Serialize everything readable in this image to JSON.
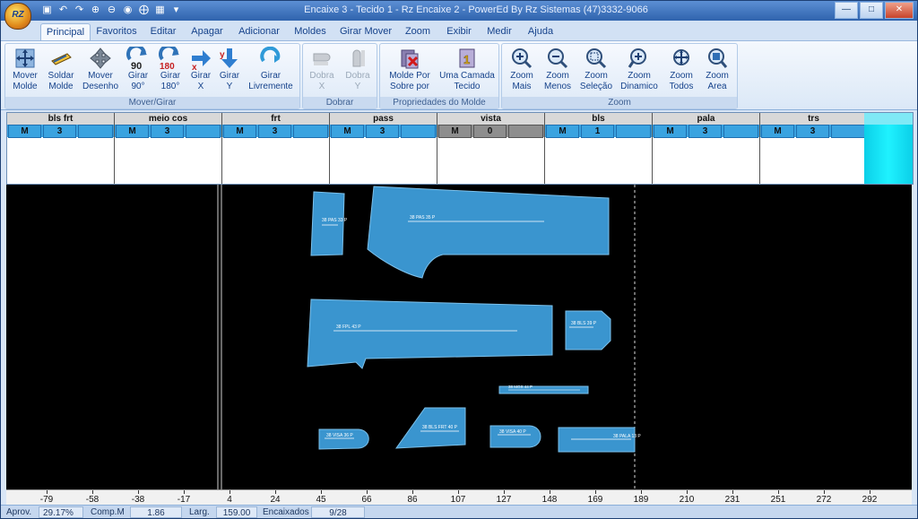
{
  "window": {
    "title": "Encaixe 3 - Tecido 1 - Rz Encaixe 2 - PowerEd By Rz Sistemas (47)3332-9066",
    "logo_text": "RZ"
  },
  "quick_access": [
    "save-icon",
    "undo-icon",
    "redo-icon",
    "zoom-in-icon",
    "zoom-out-icon",
    "zoom-fit-icon",
    "zoom-all-icon",
    "zoom-area-icon",
    "dropdown-icon"
  ],
  "tabs": [
    {
      "label": "Principal",
      "active": true
    },
    {
      "label": "Favoritos"
    },
    {
      "label": "Editar"
    },
    {
      "label": "Apagar"
    },
    {
      "label": "Adicionar"
    },
    {
      "label": "Moldes"
    },
    {
      "label": "Girar Mover"
    },
    {
      "label": "Zoom"
    },
    {
      "label": "Exibir"
    },
    {
      "label": "Medir"
    },
    {
      "label": "Ajuda"
    }
  ],
  "ribbon": {
    "mover_girar": {
      "label": "Mover/Girar",
      "buttons": [
        {
          "label": "Mover\nMolde",
          "icon": "move-piece-icon"
        },
        {
          "label": "Soldar\nMolde",
          "icon": "weld-piece-icon"
        },
        {
          "label": "Mover\nDesenho",
          "icon": "move-drawing-icon"
        },
        {
          "label": "Girar\n90°",
          "icon": "rotate-90-icon",
          "badge": "90"
        },
        {
          "label": "Girar\n180°",
          "icon": "rotate-180-icon",
          "badge": "180"
        },
        {
          "label": "Girar\nX",
          "icon": "flip-x-icon"
        },
        {
          "label": "Girar\nY",
          "icon": "flip-y-icon"
        },
        {
          "label": "Girar\nLivremente",
          "icon": "rotate-free-icon"
        }
      ]
    },
    "dobrar": {
      "label": "Dobrar",
      "buttons": [
        {
          "label": "Dobra\nX",
          "icon": "fold-x-icon"
        },
        {
          "label": "Dobra\nY",
          "icon": "fold-y-icon"
        }
      ]
    },
    "propriedades": {
      "label": "Propriedades do Molde",
      "buttons": [
        {
          "label": "Molde Por\nSobre por",
          "icon": "piece-overlap-icon"
        },
        {
          "label": "Uma Camada\nTecido",
          "icon": "single-layer-icon",
          "badge": "1"
        }
      ]
    },
    "zoom": {
      "label": "Zoom",
      "buttons": [
        {
          "label": "Zoom\nMais",
          "icon": "zoom-in-icon"
        },
        {
          "label": "Zoom\nMenos",
          "icon": "zoom-out-icon"
        },
        {
          "label": "Zoom\nSeleção",
          "icon": "zoom-selection-icon"
        },
        {
          "label": "Zoom\nDinamico",
          "icon": "zoom-dynamic-icon"
        },
        {
          "label": "Zoom\nTodos",
          "icon": "zoom-all-icon"
        },
        {
          "label": "Zoom\nArea",
          "icon": "zoom-area-icon"
        }
      ]
    }
  },
  "pieces_table": [
    {
      "name": "bls frt",
      "size": "M",
      "qty": "3"
    },
    {
      "name": "meio cos",
      "size": "M",
      "qty": "3"
    },
    {
      "name": "frt",
      "size": "M",
      "qty": "3"
    },
    {
      "name": "pass",
      "size": "M",
      "qty": "3"
    },
    {
      "name": "vista",
      "size": "M",
      "qty": "0",
      "placed": true
    },
    {
      "name": "bls",
      "size": "M",
      "qty": "1"
    },
    {
      "name": "pala",
      "size": "M",
      "qty": "3"
    },
    {
      "name": "trs",
      "size": "M",
      "qty": "3"
    }
  ],
  "canvas_pieces": [
    {
      "id": "piece-1",
      "label": "38 PAS 33 P"
    },
    {
      "id": "piece-2",
      "label": "38 PAS 35 P"
    },
    {
      "id": "piece-3",
      "label": "38 FPL 43 P"
    },
    {
      "id": "piece-4",
      "label": "38 BLS 39 P"
    },
    {
      "id": "piece-5",
      "label": "38 MOS 44 P"
    },
    {
      "id": "piece-6",
      "label": "38 VISA 36 P"
    },
    {
      "id": "piece-7",
      "label": "38 BLS FRT 40 P"
    },
    {
      "id": "piece-8",
      "label": "38 VISA 40 P"
    },
    {
      "id": "piece-9",
      "label": "38 PALA 13 P"
    }
  ],
  "ruler_labels": [
    "-79",
    "-58",
    "-38",
    "-17",
    "4",
    "24",
    "45",
    "66",
    "86",
    "107",
    "127",
    "148",
    "169",
    "189",
    "210",
    "231",
    "251",
    "272",
    "292"
  ],
  "status": {
    "aprov_label": "Aprov.",
    "aprov_value": "29.17%",
    "comp_label": "Comp.M",
    "comp_value": "1.86",
    "larg_label": "Larg.",
    "larg_value": "159.00",
    "encaixados_label": "Encaixados",
    "encaixados_value": "9/28"
  },
  "colors": {
    "piece_fill": "#3a95cf",
    "canvas_bg": "#000000",
    "table_row": "#3aa3e0"
  }
}
